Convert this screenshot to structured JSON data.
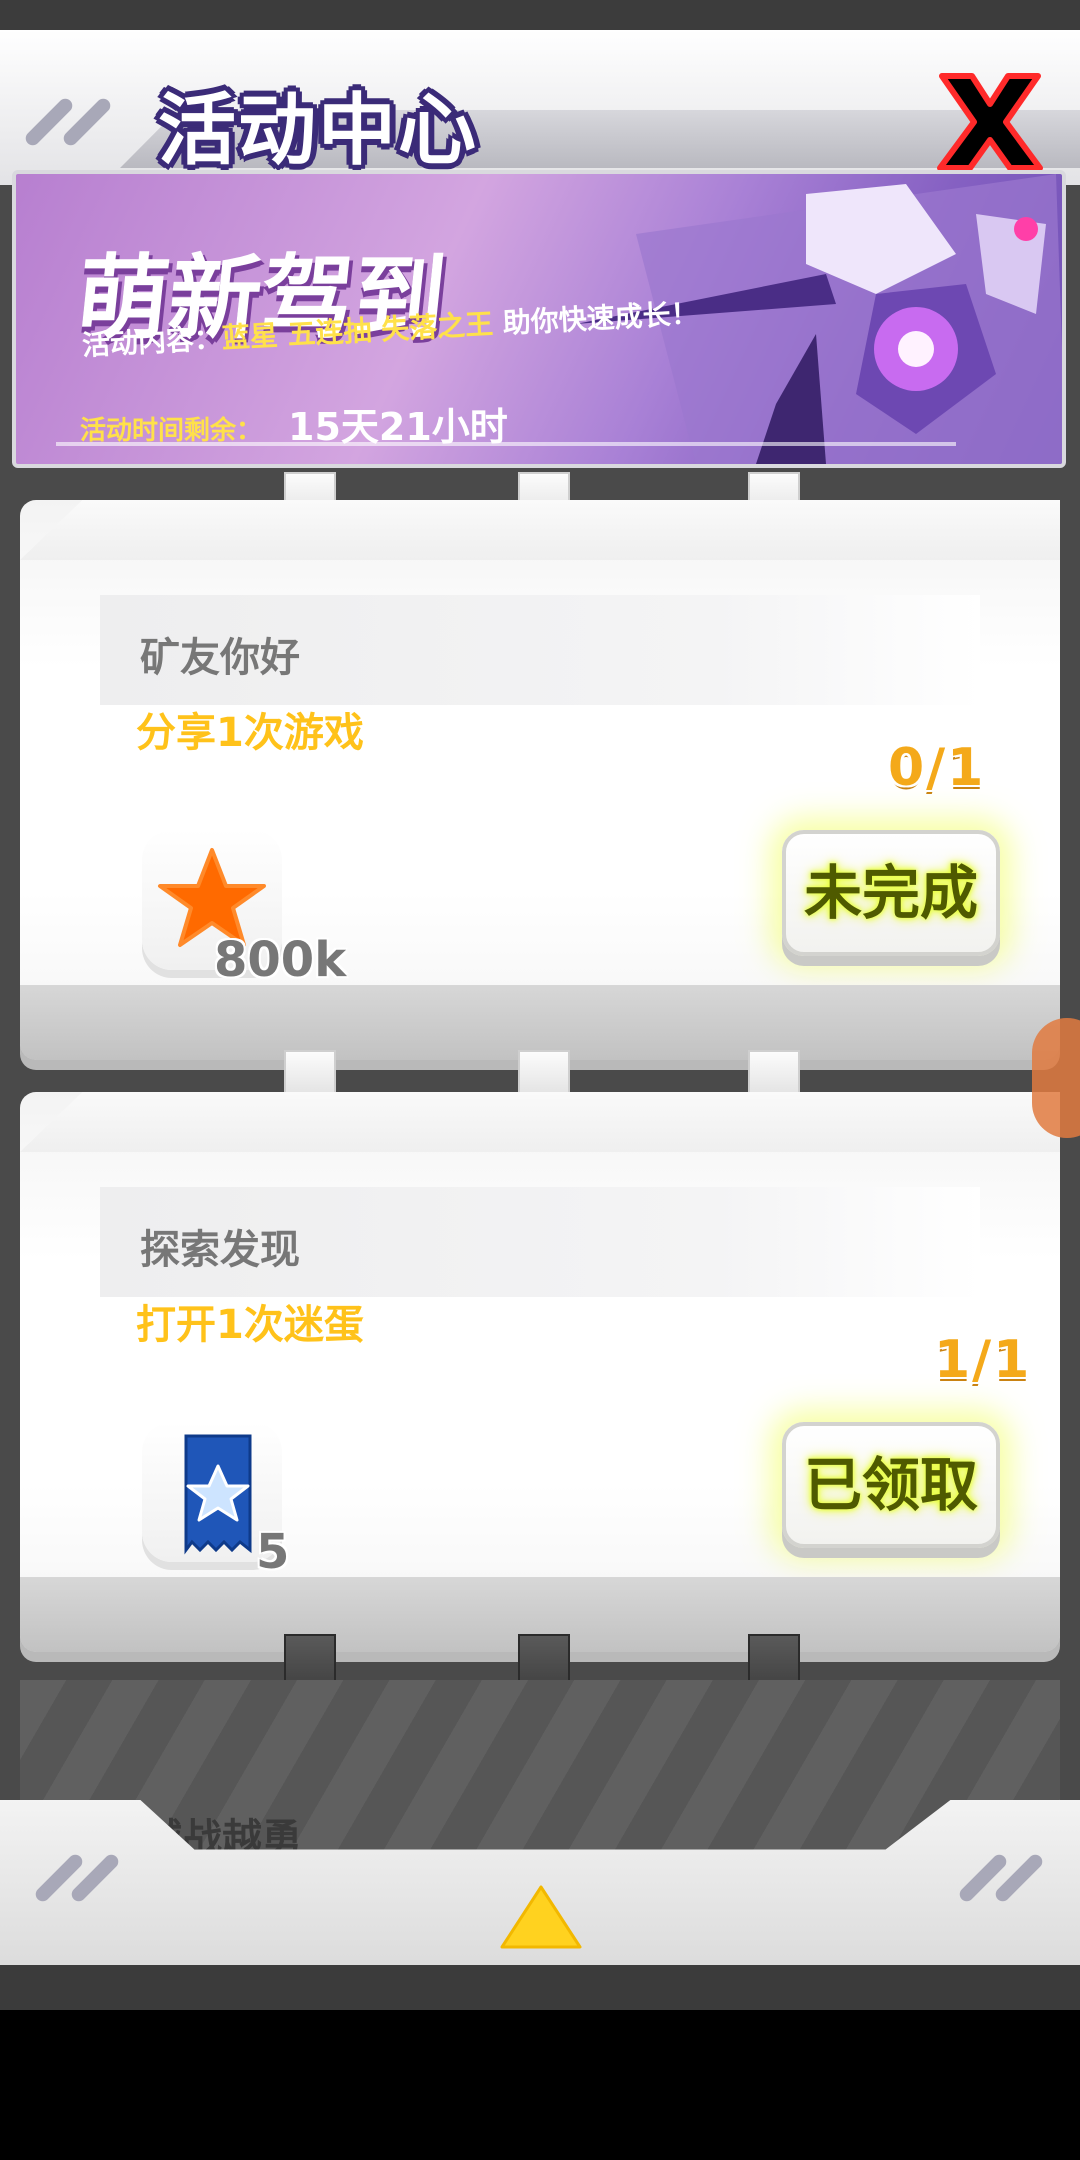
{
  "header": {
    "title": "活动中心"
  },
  "banner": {
    "title": "萌新驾到",
    "content_label": "活动内容：",
    "content_items": [
      "蓝星",
      "五连抽",
      "失落之王"
    ],
    "content_suffix": "助你快速成长！",
    "time_label": "活动时间剩余：",
    "time_value": "15天21小时"
  },
  "tasks": [
    {
      "title": "矿友你好",
      "description": "分享1次游戏",
      "progress": "0/1",
      "reward_icon": "orange-star-icon",
      "reward_qty": "800k",
      "button_label": "未完成"
    },
    {
      "title": "探索发现",
      "description": "打开1次迷蛋",
      "progress": "1/1",
      "reward_icon": "blue-star-ticket-icon",
      "reward_qty": "5",
      "button_label": "已领取"
    },
    {
      "title": "越战越勇"
    }
  ],
  "colors": {
    "accent_yellow": "#ffc21a",
    "banner_purple": "#b77fd0",
    "title_outline": "#3b2b78"
  }
}
